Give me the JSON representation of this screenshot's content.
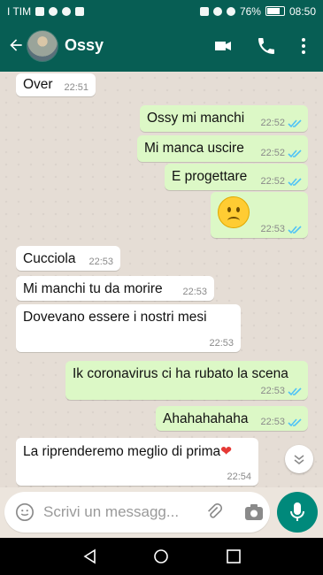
{
  "status": {
    "carrier": "I TIM",
    "battery": "76%",
    "time": "08:50"
  },
  "header": {
    "contact": "Ossy"
  },
  "messages": [
    {
      "dir": "in",
      "text": "Over",
      "time": "22:51"
    },
    {
      "dir": "out",
      "text": "Ossy mi manchi",
      "time": "22:52"
    },
    {
      "dir": "out",
      "text": "Mi manca uscire",
      "time": "22:52"
    },
    {
      "dir": "out",
      "text": "E progettare",
      "time": "22:52"
    },
    {
      "dir": "out",
      "text": "😦",
      "time": "22:53"
    },
    {
      "dir": "in",
      "text": "Cucciola",
      "time": "22:53"
    },
    {
      "dir": "in",
      "text": "Mi manchi tu da morire",
      "time": "22:53"
    },
    {
      "dir": "in",
      "text": "Dovevano essere i nostri mesi",
      "time": "22:53"
    },
    {
      "dir": "out",
      "text": "Ik coronavirus ci ha rubato la scena",
      "time": "22:53"
    },
    {
      "dir": "out",
      "text": "Ahahahahaha",
      "time": "22:53"
    },
    {
      "dir": "in",
      "text": "La riprenderemo meglio di prima",
      "time": "22:54"
    }
  ],
  "input": {
    "placeholder": "Scrivi un messagg..."
  }
}
